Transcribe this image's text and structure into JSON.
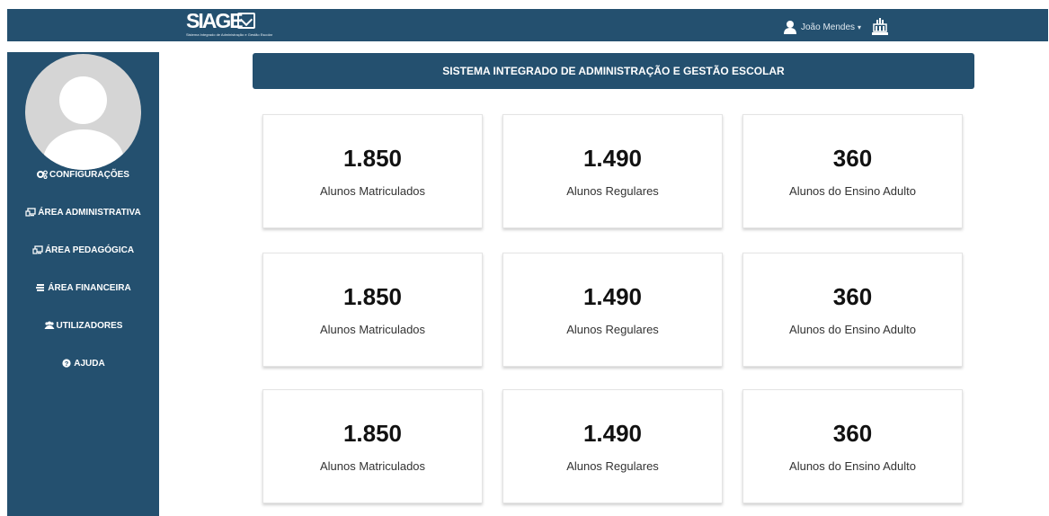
{
  "header": {
    "logo_text": "SIAGE",
    "logo_subtitle": "Sistema Integrado de Administração e Gestão Escolar",
    "user_name": "João Mendes",
    "user_icon": "user-icon",
    "caret_icon": "caret-down-icon",
    "school_icon": "building-icon"
  },
  "sidebar": {
    "avatar_icon": "avatar-placeholder",
    "items": [
      {
        "label": "CONFIGURAÇÕES",
        "icon": "cogs-icon"
      },
      {
        "label": "ÁREA ADMINISTRATIVA",
        "icon": "monitor-icon"
      },
      {
        "label": "ÁREA PEDAGÓGICA",
        "icon": "monitor-icon"
      },
      {
        "label": "ÁREA FINANCEIRA",
        "icon": "money-icon"
      },
      {
        "label": "UTILIZADORES",
        "icon": "users-icon"
      },
      {
        "label": "AJUDA",
        "icon": "question-icon"
      }
    ]
  },
  "main": {
    "title": "SISTEMA INTEGRADO DE ADMINISTRAÇÃO E GESTÃO ESCOLAR",
    "cards": [
      {
        "value": "1.850",
        "label": "Alunos Matriculados"
      },
      {
        "value": "1.490",
        "label": "Alunos Regulares"
      },
      {
        "value": "360",
        "label": "Alunos do Ensino Adulto"
      },
      {
        "value": "1.850",
        "label": "Alunos Matriculados"
      },
      {
        "value": "1.490",
        "label": "Alunos Regulares"
      },
      {
        "value": "360",
        "label": "Alunos do Ensino Adulto"
      },
      {
        "value": "1.850",
        "label": "Alunos Matriculados"
      },
      {
        "value": "1.490",
        "label": "Alunos Regulares"
      },
      {
        "value": "360",
        "label": "Alunos do Ensino Adulto"
      }
    ]
  },
  "colors": {
    "primary": "#24506f",
    "background": "#ffffff",
    "avatar_bg": "#d5d5d5"
  }
}
